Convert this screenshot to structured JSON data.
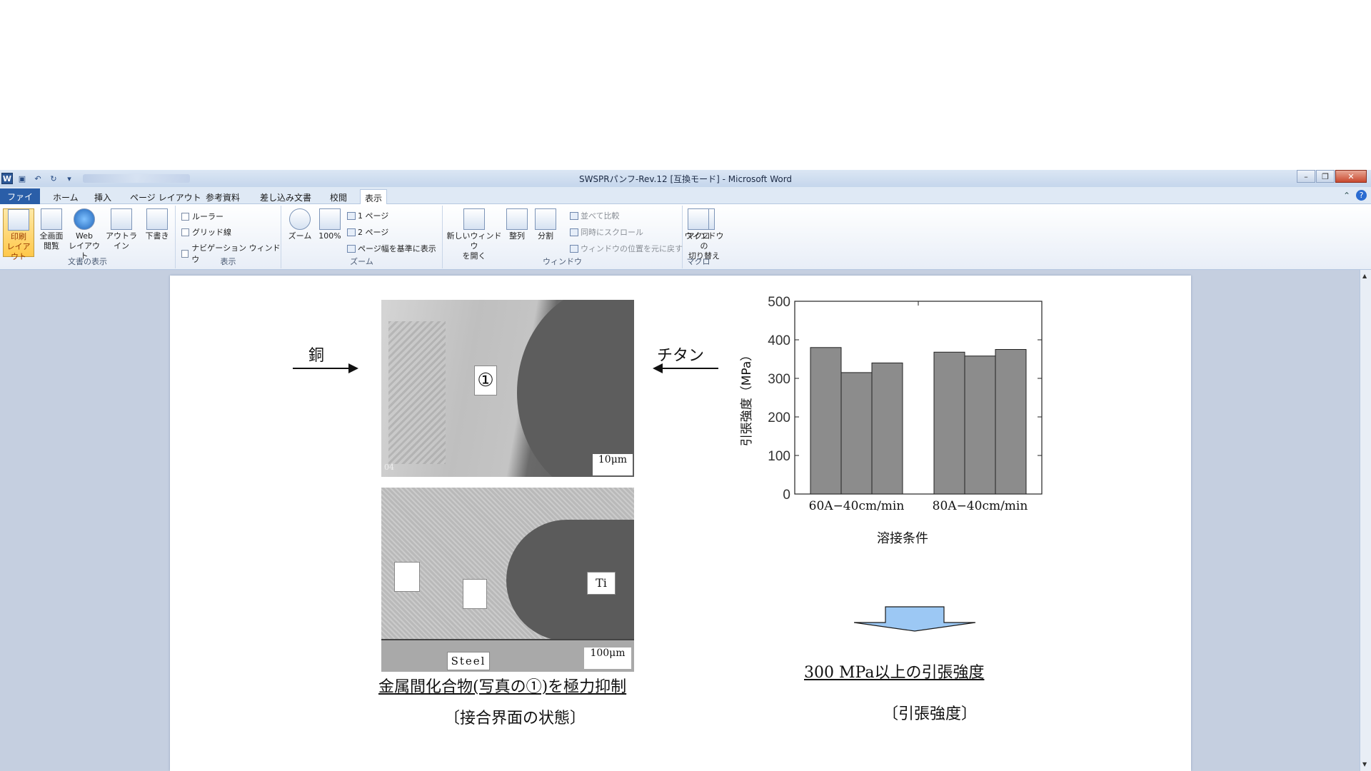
{
  "window": {
    "title": "SWSPRパンフ-Rev.12 [互換モード] - Microsoft Word",
    "logo": "W",
    "controls": {
      "minimize": "–",
      "restore": "❐",
      "close": "✕"
    }
  },
  "tabs": {
    "file": "ファイル",
    "items": [
      "ホーム",
      "挿入",
      "ページ レイアウト",
      "参考資料",
      "差し込み文書",
      "校閲",
      "表示"
    ],
    "active": "表示"
  },
  "ribbon": {
    "doc_view": {
      "label": "文書の表示",
      "print_layout": "印刷\nレイアウト",
      "full_screen": "全画面\n閲覧",
      "web_layout": "Web\nレイアウト",
      "outline": "アウトライン",
      "draft": "下書き"
    },
    "show": {
      "label": "表示",
      "ruler": "ルーラー",
      "gridlines": "グリッド線",
      "nav_pane": "ナビゲーション ウィンドウ"
    },
    "zoom": {
      "label": "ズーム",
      "zoom": "ズーム",
      "hundred": "100%",
      "one_page": "1 ページ",
      "two_pages": "2 ページ",
      "page_width": "ページ幅を基準に表示"
    },
    "window": {
      "label": "ウィンドウ",
      "new_window": "新しいウィンドウ\nを開く",
      "arrange": "整列",
      "split": "分割",
      "side_by_side": "並べて比較",
      "sync_scroll": "同時にスクロール",
      "reset_pos": "ウィンドウの位置を元に戻す",
      "switch": "ウィンドウの\n切り替え"
    },
    "macro": {
      "label": "マクロ",
      "macro": "マクロ"
    }
  },
  "document": {
    "copper_label": "銅",
    "titanium_label": "チタン",
    "marker": "①",
    "scale1": "10μm",
    "scale2": "100μm",
    "ti_label": "Ti",
    "steel_label": "Steel",
    "left_caption": "金属間化合物(写真の①)を極力抑制",
    "left_subcaption": "〔接合界面の状態〕",
    "right_caption": "300 MPa以上の引張強度",
    "right_subcaption": "〔引張強度〕",
    "photo_corner": "04"
  },
  "chart_data": {
    "type": "bar",
    "categories": [
      "60A−40cm/min",
      "80A−40cm/min"
    ],
    "series_values": [
      [
        380,
        315,
        340
      ],
      [
        368,
        358,
        375
      ]
    ],
    "ylabel": "引張強度（MPa）",
    "xlabel": "溶接条件",
    "ylim": [
      0,
      500
    ],
    "yticks": [
      0,
      100,
      200,
      300,
      400,
      500
    ],
    "bar_color": "#8c8c8c",
    "grid": false
  }
}
